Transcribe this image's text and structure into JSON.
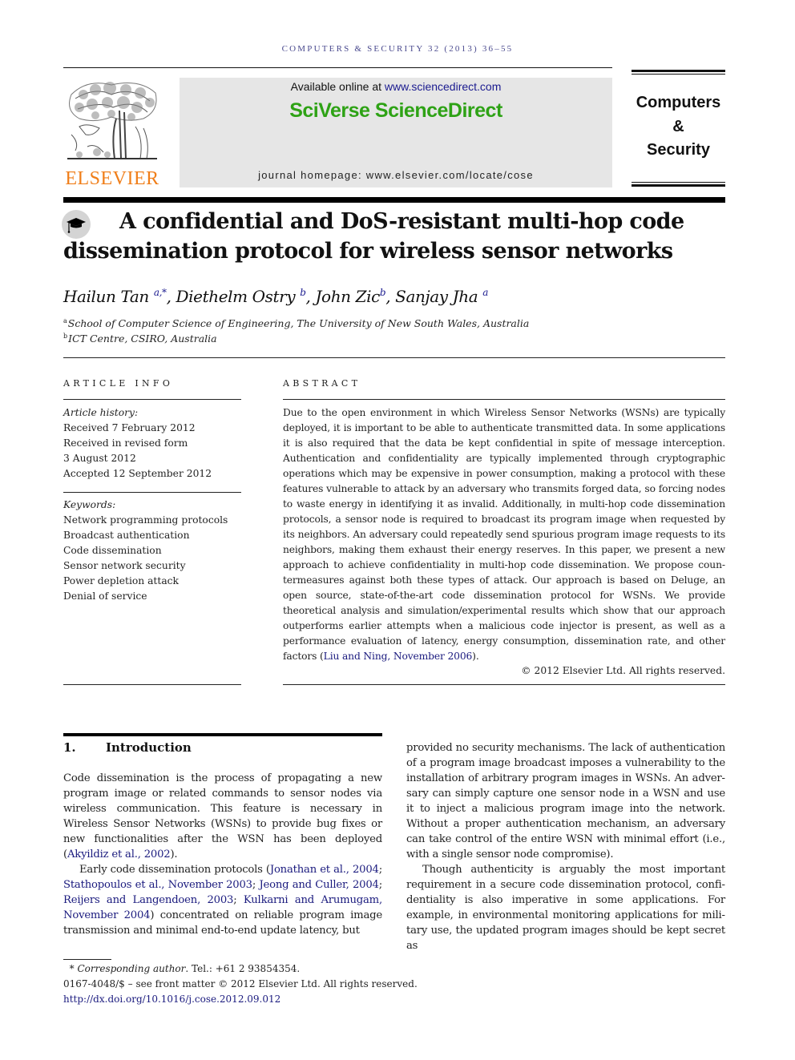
{
  "running_head": "COMPUTERS & SECURITY 32 (2013) 36–55",
  "publisher": {
    "logo_icon": "elsevier-tree-logo",
    "name": "ELSEVIER",
    "brand_color": "#f07e19"
  },
  "sciencedirect": {
    "available_prefix": "Available online at ",
    "available_link": "www.sciencedirect.com",
    "brand": "SciVerse ScienceDirect",
    "brand_color": "#2ea215",
    "homepage_prefix": "journal homepage: ",
    "homepage_url": "www.elsevier.com/locate/cose"
  },
  "journal": {
    "line1": "Computers",
    "line2": "&",
    "line3": "Security"
  },
  "article": {
    "crossmark_icon": "crossmark-mortarboard-icon",
    "title_line1": "A confidential and DoS-resistant multi-hop code",
    "title_line2": "dissemination protocol for wireless sensor networks",
    "authors": [
      {
        "name": "Hailun Tan",
        "sup": "a,*",
        "sep": ", "
      },
      {
        "name": "Diethelm Ostry",
        "sup": "b",
        "sep": ", "
      },
      {
        "name": "John Zic",
        "sup": "b",
        "sep": ", "
      },
      {
        "name": "Sanjay Jha",
        "sup": "a",
        "sep": ""
      }
    ],
    "affiliations": [
      {
        "mark": "a",
        "text": "School of Computer Science of Engineering, The University of New South Wales, Australia"
      },
      {
        "mark": "b",
        "text": "ICT Centre, CSIRO, Australia"
      }
    ]
  },
  "article_info": {
    "heading": "ARTICLE INFO",
    "history_label": "Article history:",
    "history": [
      "Received 7 February 2012",
      "Received in revised form",
      "3 August 2012",
      "Accepted 12 September 2012"
    ],
    "keywords_label": "Keywords:",
    "keywords": [
      "Network programming protocols",
      "Broadcast authentication",
      "Code dissemination",
      "Sensor network security",
      "Power depletion attack",
      "Denial of service"
    ]
  },
  "abstract": {
    "heading": "ABSTRACT",
    "text": "Due to the open environment in which Wireless Sensor Networks (WSNs) are typically deployed, it is important to be able to authenticate transmitted data. In some applications it is also required that the data be kept confidential in spite of message interception. Authentication and confidentiality are typically implemented through cryptographic operations which may be expensive in power consumption, making a protocol with these features vulnerable to attack by an adversary who transmits forged data, so forcing nodes to waste energy in identifying it as invalid. Additionally, in multi-hop code dissemination protocols, a sensor node is required to broadcast its program image when requested by its neighbors. An adversary could repeatedly send spurious program image requests to its neighbors, making them exhaust their energy reserves. In this paper, we present a new approach to achieve confidentiality in multi-hop code dissemination. We propose coun­termeasures against both these types of attack. Our approach is based on Deluge, an open source, state-of-the-art code dissemination protocol for WSNs. We provide theoretical analysis and simulation/experimental results which show that our approach outperforms earlier attempts when a malicious code injector is present, as well as a performance evaluation of latency, energy consumption, dissemination rate, and other factors (",
    "citation": "Liu and Ning, November 2006",
    "text_end": ").",
    "copyright": "© 2012 Elsevier Ltd. All rights reserved."
  },
  "introduction": {
    "number": "1.",
    "heading": "Introduction",
    "p1_text": "Code dissemination is the process of propagating a new program image or related commands to sensor nodes via wireless communication. This feature is necessary in Wireless Sensor Networks (WSNs) to provide bug fixes or new func­tionalities after the WSN has been deployed (",
    "p1_cite": "Akyildiz et al., 2002",
    "p1_end": ").",
    "p2_text": "Early code dissemination protocols (",
    "p2_cites": [
      "Jonathan et al., 2004",
      "Stathopoulos et al., November 2003",
      "Jeong and Culler, 2004",
      "Reijers and Langendoen, 2003",
      "Kulkarni and Arumugam, November 2004"
    ],
    "p2_end": ") concentrated on reliable program image transmission and minimal end-to-end update latency, but provided no security mechanisms. The lack of authentication of a program image broadcast imposes a vulnerability to the installation of arbitrary program images in WSNs. An adver­sary can simply capture one sensor node in a WSN and use it to inject a malicious program image into the network. Without a proper authentication mechanism, an adversary can take control of the entire WSN with minimal effort (i.e., with a single sensor node compromise).",
    "p3_text": "Though authenticity is arguably the most important requirement in a secure code dissemination protocol, confi­dentiality is also imperative in some applications. For example, in environmental monitoring applications for mili­tary use, the updated program images should be kept secret as"
  },
  "footnotes": {
    "corresponding_mark": "*",
    "corresponding_label": "Corresponding author",
    "corresponding_text": ". Tel.: +61 2 93854354.",
    "issn_line": "0167-4048/$ – see front matter © 2012 Elsevier Ltd. All rights reserved.",
    "doi": "http://dx.doi.org/10.1016/j.cose.2012.09.012"
  }
}
